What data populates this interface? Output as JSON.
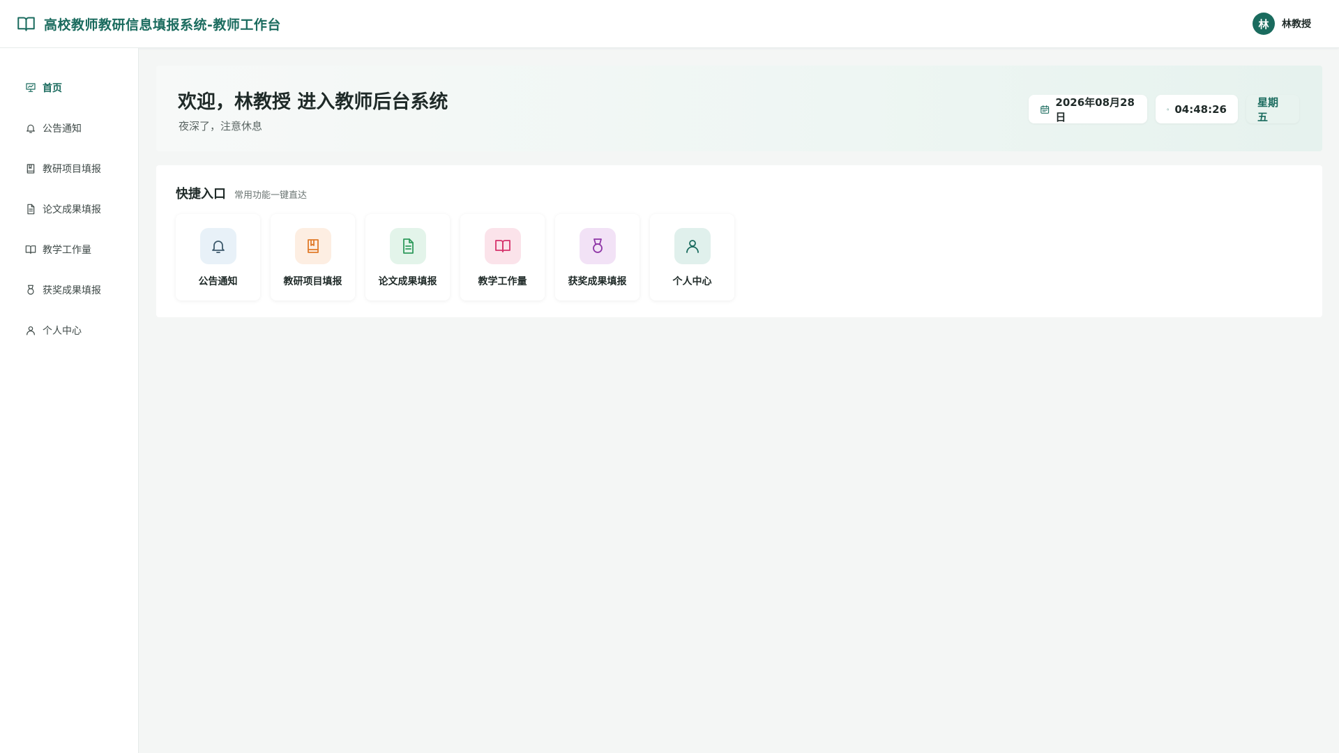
{
  "header": {
    "brand_icon": "book-open-icon",
    "title": "高校教师教研信息填报系统-教师工作台",
    "user_initial": "林",
    "user_name": "林教授"
  },
  "sidebar": {
    "items": [
      {
        "label": "首页",
        "icon": "presentation-icon",
        "active": true
      },
      {
        "label": "公告通知",
        "icon": "bell-icon",
        "active": false
      },
      {
        "label": "教研项目填报",
        "icon": "book-icon",
        "active": false
      },
      {
        "label": "论文成果填报",
        "icon": "document-icon",
        "active": false
      },
      {
        "label": "教学工作量",
        "icon": "open-book-icon",
        "active": false
      },
      {
        "label": "获奖成果填报",
        "icon": "medal-icon",
        "active": false
      },
      {
        "label": "个人中心",
        "icon": "user-icon",
        "active": false
      }
    ]
  },
  "welcome": {
    "title": "欢迎，林教授 进入教师后台系统",
    "subtitle": "夜深了，注意休息",
    "date": "2026年08月28日",
    "time": "04:48:26",
    "weekday": "星期五"
  },
  "quick": {
    "title": "快捷入口",
    "subtitle": "常用功能一键直达",
    "tiles": [
      {
        "label": "公告通知",
        "icon": "bell-icon",
        "color": "#3d5a6c",
        "bg": "#e8f1f8"
      },
      {
        "label": "教研项目填报",
        "icon": "book-icon",
        "color": "#e07b2a",
        "bg": "#fdeee2"
      },
      {
        "label": "论文成果填报",
        "icon": "document-icon",
        "color": "#2f9a5c",
        "bg": "#e3f4ea"
      },
      {
        "label": "教学工作量",
        "icon": "open-book-icon",
        "color": "#d6336c",
        "bg": "#fbe3ea"
      },
      {
        "label": "获奖成果填报",
        "icon": "medal-icon",
        "color": "#8e35a6",
        "bg": "#f2e2f6"
      },
      {
        "label": "个人中心",
        "icon": "user-icon",
        "color": "#1a6b5e",
        "bg": "#e0f0ec"
      }
    ]
  },
  "colors": {
    "brand": "#1a6b5e",
    "background": "#f4f6f5"
  }
}
